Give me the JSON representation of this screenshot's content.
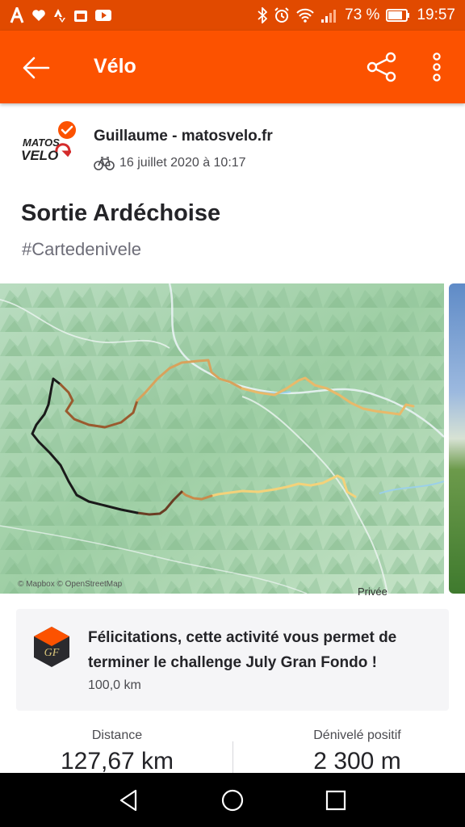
{
  "status_bar": {
    "battery_percent": "73 %",
    "time": "19:57"
  },
  "app_bar": {
    "title": "Vélo"
  },
  "activity": {
    "athlete_name": "Guillaume - matosvelo.fr",
    "date": "16 juillet 2020 à 10:17",
    "title": "Sortie Ardéchoise",
    "description": "#Cartedenivele"
  },
  "avatar": {
    "logo_text": "MATOS VELO"
  },
  "map": {
    "attribution": "© Mapbox © OpenStreetMap",
    "privacy_label": "Privée"
  },
  "challenge": {
    "message": "Félicitations, cette activité vous permet de terminer le challenge July Gran Fondo !",
    "goal": "100,0 km"
  },
  "stats": [
    {
      "label": "Distance",
      "value": "127,67 km"
    },
    {
      "label": "Dénivelé positif",
      "value": "2 300 m"
    }
  ],
  "colors": {
    "brand_orange": "#fc5200",
    "status_bar": "#e14a00",
    "route_low": "#f3d27a",
    "route_high": "#1a1a1a"
  },
  "icons": [
    "back-arrow-icon",
    "share-icon",
    "more-vert-icon",
    "bike-icon",
    "verified-icon",
    "challenge-badge-icon",
    "nav-back-icon",
    "nav-home-icon",
    "nav-recents-icon"
  ]
}
